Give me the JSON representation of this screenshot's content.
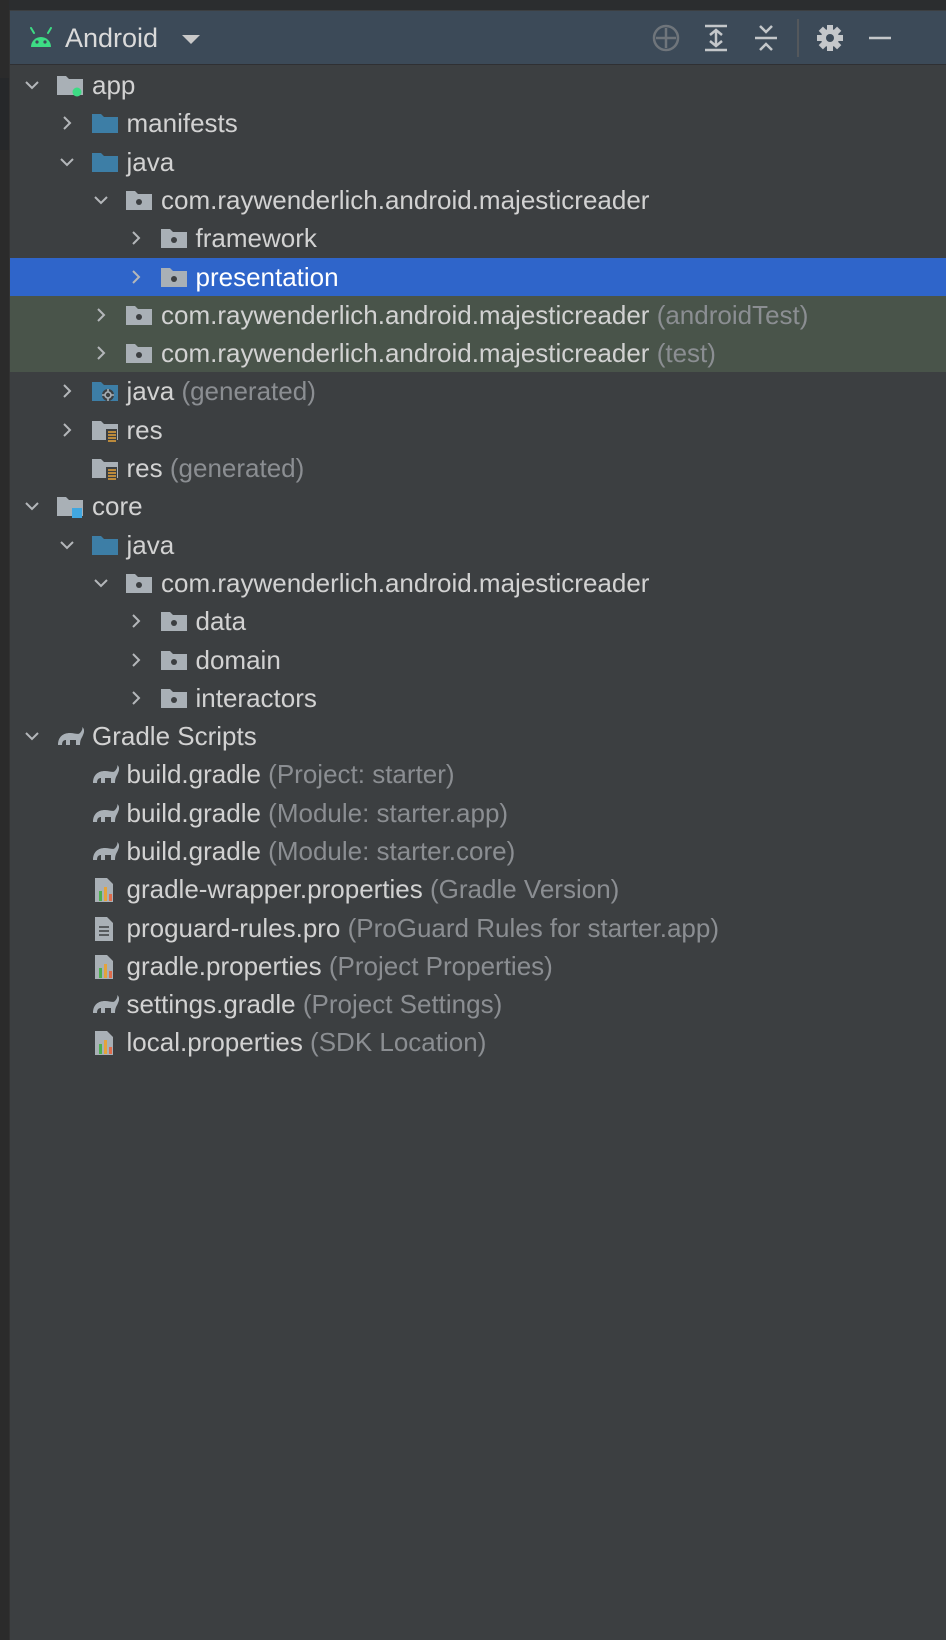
{
  "toolbar": {
    "view_label": "Android",
    "icons": [
      "locate-icon",
      "expand-all-icon",
      "collapse-all-icon",
      "gear-icon",
      "minimize-icon"
    ]
  },
  "colors": {
    "selection": "#2f65ca",
    "test_source_bg": "#49544a",
    "hint_text": "#8b8e92",
    "folder_blue": "#3d7ea6",
    "android_green": "#3ddc84"
  },
  "tree": [
    {
      "level": 0,
      "expanded": true,
      "icon": "module-app-icon",
      "label": "app",
      "hint": ""
    },
    {
      "level": 1,
      "expanded": false,
      "icon": "folder-blue-icon",
      "label": "manifests",
      "hint": ""
    },
    {
      "level": 1,
      "expanded": true,
      "icon": "folder-blue-icon",
      "label": "java",
      "hint": ""
    },
    {
      "level": 2,
      "expanded": true,
      "icon": "package-icon",
      "label": "com.raywenderlich.android.majesticreader",
      "hint": ""
    },
    {
      "level": 3,
      "expanded": false,
      "icon": "package-icon",
      "label": "framework",
      "hint": ""
    },
    {
      "level": 3,
      "expanded": false,
      "icon": "package-icon",
      "label": "presentation",
      "hint": "",
      "selected": true
    },
    {
      "level": 2,
      "expanded": false,
      "icon": "package-icon",
      "label": "com.raywenderlich.android.majesticreader",
      "hint": "(androidTest)",
      "test": true
    },
    {
      "level": 2,
      "expanded": false,
      "icon": "package-icon",
      "label": "com.raywenderlich.android.majesticreader",
      "hint": "(test)",
      "test": true
    },
    {
      "level": 1,
      "expanded": false,
      "icon": "folder-generated-icon",
      "label": "java",
      "hint": "(generated)"
    },
    {
      "level": 1,
      "expanded": false,
      "icon": "res-folder-icon",
      "label": "res",
      "hint": ""
    },
    {
      "level": 1,
      "expanded": null,
      "icon": "res-folder-icon",
      "label": "res",
      "hint": "(generated)"
    },
    {
      "level": 0,
      "expanded": true,
      "icon": "module-lib-icon",
      "label": "core",
      "hint": ""
    },
    {
      "level": 1,
      "expanded": true,
      "icon": "folder-blue-icon",
      "label": "java",
      "hint": ""
    },
    {
      "level": 2,
      "expanded": true,
      "icon": "package-icon",
      "label": "com.raywenderlich.android.majesticreader",
      "hint": ""
    },
    {
      "level": 3,
      "expanded": false,
      "icon": "package-icon",
      "label": "data",
      "hint": ""
    },
    {
      "level": 3,
      "expanded": false,
      "icon": "package-icon",
      "label": "domain",
      "hint": ""
    },
    {
      "level": 3,
      "expanded": false,
      "icon": "package-icon",
      "label": "interactors",
      "hint": ""
    },
    {
      "level": 0,
      "expanded": true,
      "icon": "gradle-icon",
      "label": "Gradle Scripts",
      "hint": ""
    },
    {
      "level": 1,
      "expanded": null,
      "icon": "gradle-icon",
      "label": "build.gradle",
      "hint": "(Project: starter)"
    },
    {
      "level": 1,
      "expanded": null,
      "icon": "gradle-icon",
      "label": "build.gradle",
      "hint": "(Module: starter.app)"
    },
    {
      "level": 1,
      "expanded": null,
      "icon": "gradle-icon",
      "label": "build.gradle",
      "hint": "(Module: starter.core)"
    },
    {
      "level": 1,
      "expanded": null,
      "icon": "properties-icon",
      "label": "gradle-wrapper.properties",
      "hint": "(Gradle Version)"
    },
    {
      "level": 1,
      "expanded": null,
      "icon": "text-file-icon",
      "label": "proguard-rules.pro",
      "hint": "(ProGuard Rules for starter.app)"
    },
    {
      "level": 1,
      "expanded": null,
      "icon": "properties-icon",
      "label": "gradle.properties",
      "hint": "(Project Properties)"
    },
    {
      "level": 1,
      "expanded": null,
      "icon": "gradle-icon",
      "label": "settings.gradle",
      "hint": "(Project Settings)"
    },
    {
      "level": 1,
      "expanded": null,
      "icon": "properties-icon",
      "label": "local.properties",
      "hint": "(SDK Location)"
    }
  ]
}
